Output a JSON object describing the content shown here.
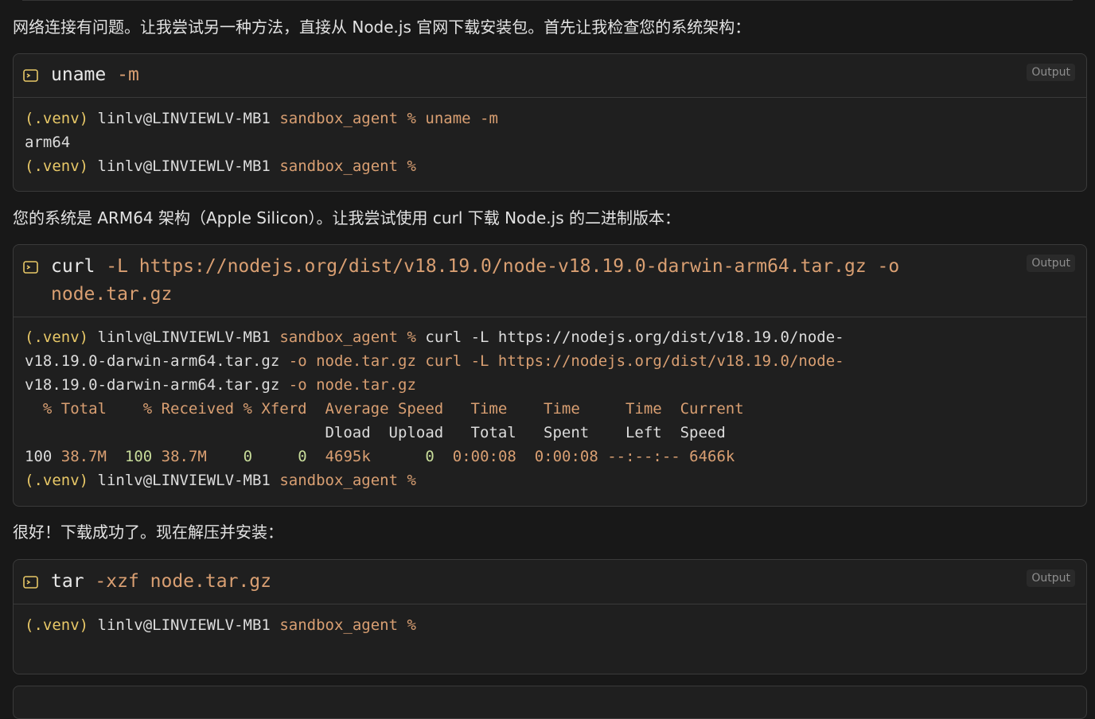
{
  "messages": [
    "网络连接有问题。让我尝试另一种方法，直接从 Node.js 官网下载安装包。首先让我检查您的系统架构：",
    "您的系统是 ARM64 架构（Apple Silicon）。让我尝试使用 curl 下载 Node.js 的二进制版本：",
    "很好！下载成功了。现在解压并安装："
  ],
  "output_label": "Output",
  "prompt": {
    "venv": "(.venv)",
    "user_host": "linlv@LINVIEWLV-MB1",
    "dir": "sandbox_agent",
    "symbol": "%"
  },
  "blocks": [
    {
      "cmd_name": "uname",
      "cmd_args": "-m"
    },
    {
      "cmd_name": "curl",
      "cmd_args_line1": "-L https://nodejs.org/dist/v18.19.0/node-v18.19.0-darwin-arm64.tar.gz -o",
      "cmd_args_line2": "node.tar.gz"
    },
    {
      "cmd_name": "tar",
      "cmd_args": "-xzf node.tar.gz"
    }
  ],
  "uname_output": {
    "cmd": "uname -m",
    "result": "arm64"
  },
  "curl_output": {
    "cmd_part1": "curl -L https://nodejs.org/dist/v18.19.0/node-",
    "wrap1_a": "v18.19.0-darwin-arm64.tar.gz",
    "wrap1_b": "-o",
    "wrap1_c": "node.tar.gz",
    "wrap1_d": "curl -L https://nodejs.org/dist/v18.19.0/node-",
    "wrap2_a": "v18.19.0-darwin-arm64.tar.gz",
    "wrap2_b": "-o",
    "wrap2_c": "node.tar.gz",
    "header1": "  % Total    % Received % Xferd  Average Speed   Time    Time     Time  Current",
    "header2": "                                 Dload  Upload   Total   Spent    Left  Speed",
    "row_a": "100",
    "row_b": "38.7M",
    "row_c": "100",
    "row_d": "38.7M",
    "row_e": "    0     0",
    "row_f": "4695k",
    "row_g": "      0",
    "row_h": "0:00:08  0:00:08 --:--:-- 6466k"
  },
  "colors": {
    "background": "#181818",
    "block_bg": "#1f1f1f",
    "venv_yellow": "#e8c867",
    "path_orange": "#d99f72",
    "number_green": "#c8dc9a"
  },
  "icons": [
    "terminal-icon"
  ]
}
